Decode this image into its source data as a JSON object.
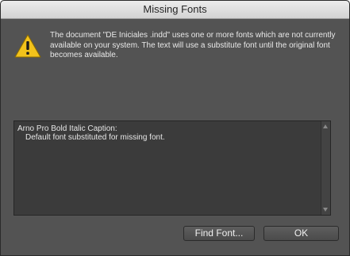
{
  "window": {
    "title": "Missing Fonts"
  },
  "alert": {
    "icon": "warning-icon",
    "message": "The document \"DE Iniciales .indd\" uses one or more fonts which are not currently available on your system. The text will use a substitute font until the original font becomes available."
  },
  "missing_fonts": {
    "items": [
      {
        "font": "Arno Pro Bold Italic Caption:",
        "detail": "Default font substituted for missing font."
      }
    ]
  },
  "buttons": {
    "find_font": "Find Font...",
    "ok": "OK"
  },
  "colors": {
    "dialog_bg": "#535353",
    "list_bg": "#3b3b3b",
    "warning_yellow": "#f2c21b"
  }
}
